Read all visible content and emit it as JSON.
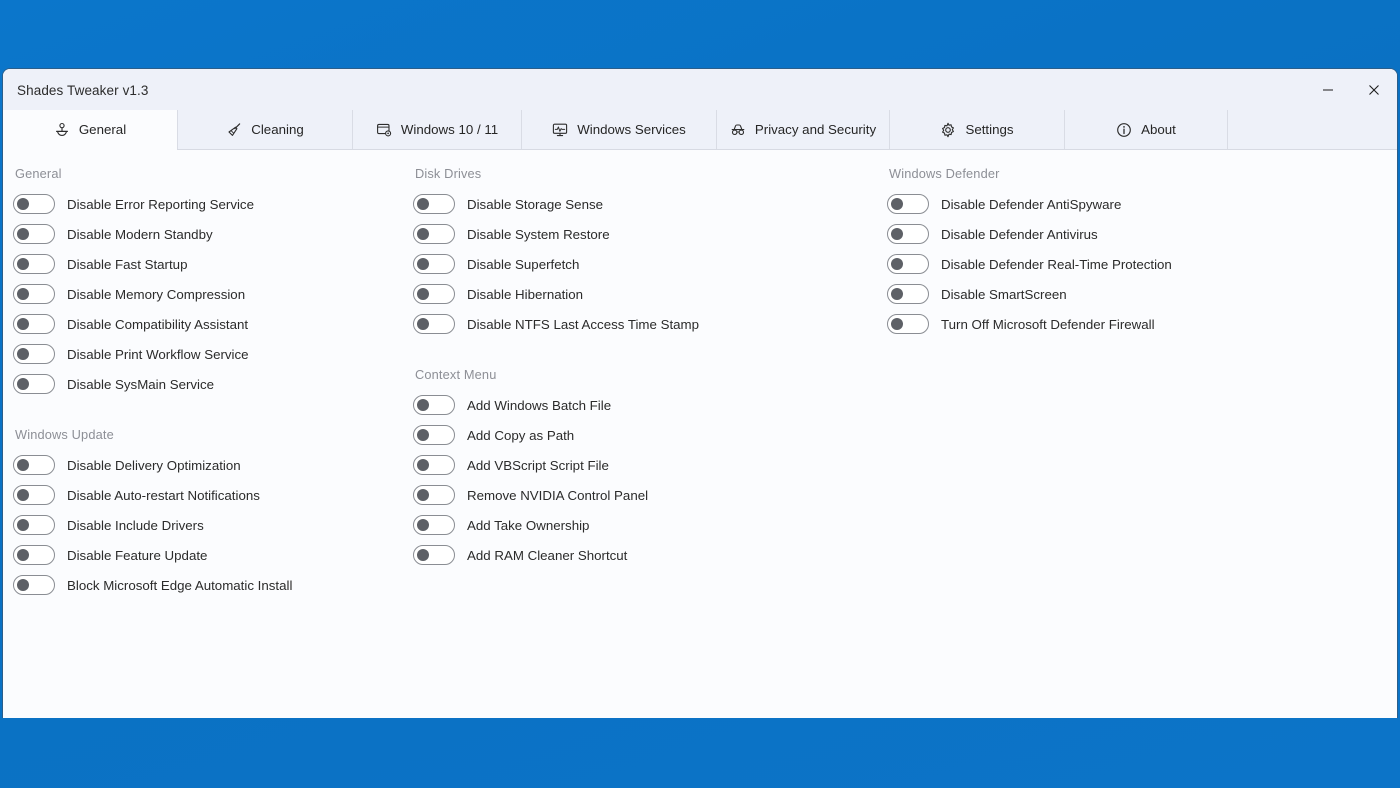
{
  "window": {
    "title": "Shades Tweaker v1.3",
    "controls": [
      {
        "name": "minimize-button",
        "glyph": "minimize"
      },
      {
        "name": "close-button",
        "glyph": "close"
      }
    ]
  },
  "colors": {
    "desktop_background": "#0a72c6",
    "titlebar_background": "#eef1f9",
    "tab_inactive_background": "#eef1f9",
    "tab_active_background": "#fbfcfe",
    "content_background": "#fbfcfe",
    "section_title": "#8d8f96",
    "label_text": "#2b2b2b",
    "toggle_knob": "#5d6066",
    "toggle_border": "#8a8d93",
    "window_border": "#2b5e8a"
  },
  "tabs": [
    {
      "label": "General",
      "icon": "account-service-icon",
      "active": true
    },
    {
      "label": "Cleaning",
      "icon": "broom-icon",
      "active": false
    },
    {
      "label": "Windows 10 / 11",
      "icon": "window-gear-icon",
      "active": false
    },
    {
      "label": "Windows Services",
      "icon": "monitor-pulse-icon",
      "active": false
    },
    {
      "label": "Privacy and Security",
      "icon": "incognito-icon",
      "active": false
    },
    {
      "label": "Settings",
      "icon": "gear-icon",
      "active": false
    },
    {
      "label": "About",
      "icon": "info-icon",
      "active": false
    }
  ],
  "columns": [
    {
      "id": "left",
      "sections": [
        {
          "title": "General",
          "items": [
            {
              "label": "Disable Error Reporting Service",
              "on": false
            },
            {
              "label": "Disable Modern Standby",
              "on": false
            },
            {
              "label": "Disable Fast Startup",
              "on": false
            },
            {
              "label": "Disable Memory Compression",
              "on": false
            },
            {
              "label": "Disable Compatibility Assistant",
              "on": false
            },
            {
              "label": "Disable Print Workflow Service",
              "on": false
            },
            {
              "label": "Disable SysMain Service",
              "on": false
            }
          ]
        },
        {
          "title": "Windows Update",
          "items": [
            {
              "label": "Disable Delivery Optimization",
              "on": false
            },
            {
              "label": "Disable Auto-restart Notifications",
              "on": false
            },
            {
              "label": "Disable Include Drivers",
              "on": false
            },
            {
              "label": "Disable Feature Update",
              "on": false
            },
            {
              "label": "Block Microsoft Edge Automatic Install",
              "on": false
            }
          ]
        }
      ]
    },
    {
      "id": "middle",
      "sections": [
        {
          "title": "Disk Drives",
          "items": [
            {
              "label": "Disable Storage Sense",
              "on": false
            },
            {
              "label": "Disable System Restore",
              "on": false
            },
            {
              "label": "Disable Superfetch",
              "on": false
            },
            {
              "label": "Disable Hibernation",
              "on": false
            },
            {
              "label": "Disable NTFS Last Access Time Stamp",
              "on": false
            }
          ]
        },
        {
          "title": "Context Menu",
          "items": [
            {
              "label": "Add Windows Batch File",
              "on": false
            },
            {
              "label": "Add Copy as Path",
              "on": false
            },
            {
              "label": "Add VBScript Script File",
              "on": false
            },
            {
              "label": "Remove NVIDIA Control Panel",
              "on": false
            },
            {
              "label": "Add Take Ownership",
              "on": false
            },
            {
              "label": "Add RAM Cleaner Shortcut",
              "on": false
            }
          ]
        }
      ]
    },
    {
      "id": "right",
      "sections": [
        {
          "title": "Windows Defender",
          "items": [
            {
              "label": "Disable Defender AntiSpyware",
              "on": false
            },
            {
              "label": "Disable Defender Antivirus",
              "on": false
            },
            {
              "label": "Disable Defender Real-Time Protection",
              "on": false
            },
            {
              "label": "Disable SmartScreen",
              "on": false
            },
            {
              "label": "Turn Off Microsoft Defender Firewall",
              "on": false
            }
          ]
        }
      ]
    }
  ]
}
